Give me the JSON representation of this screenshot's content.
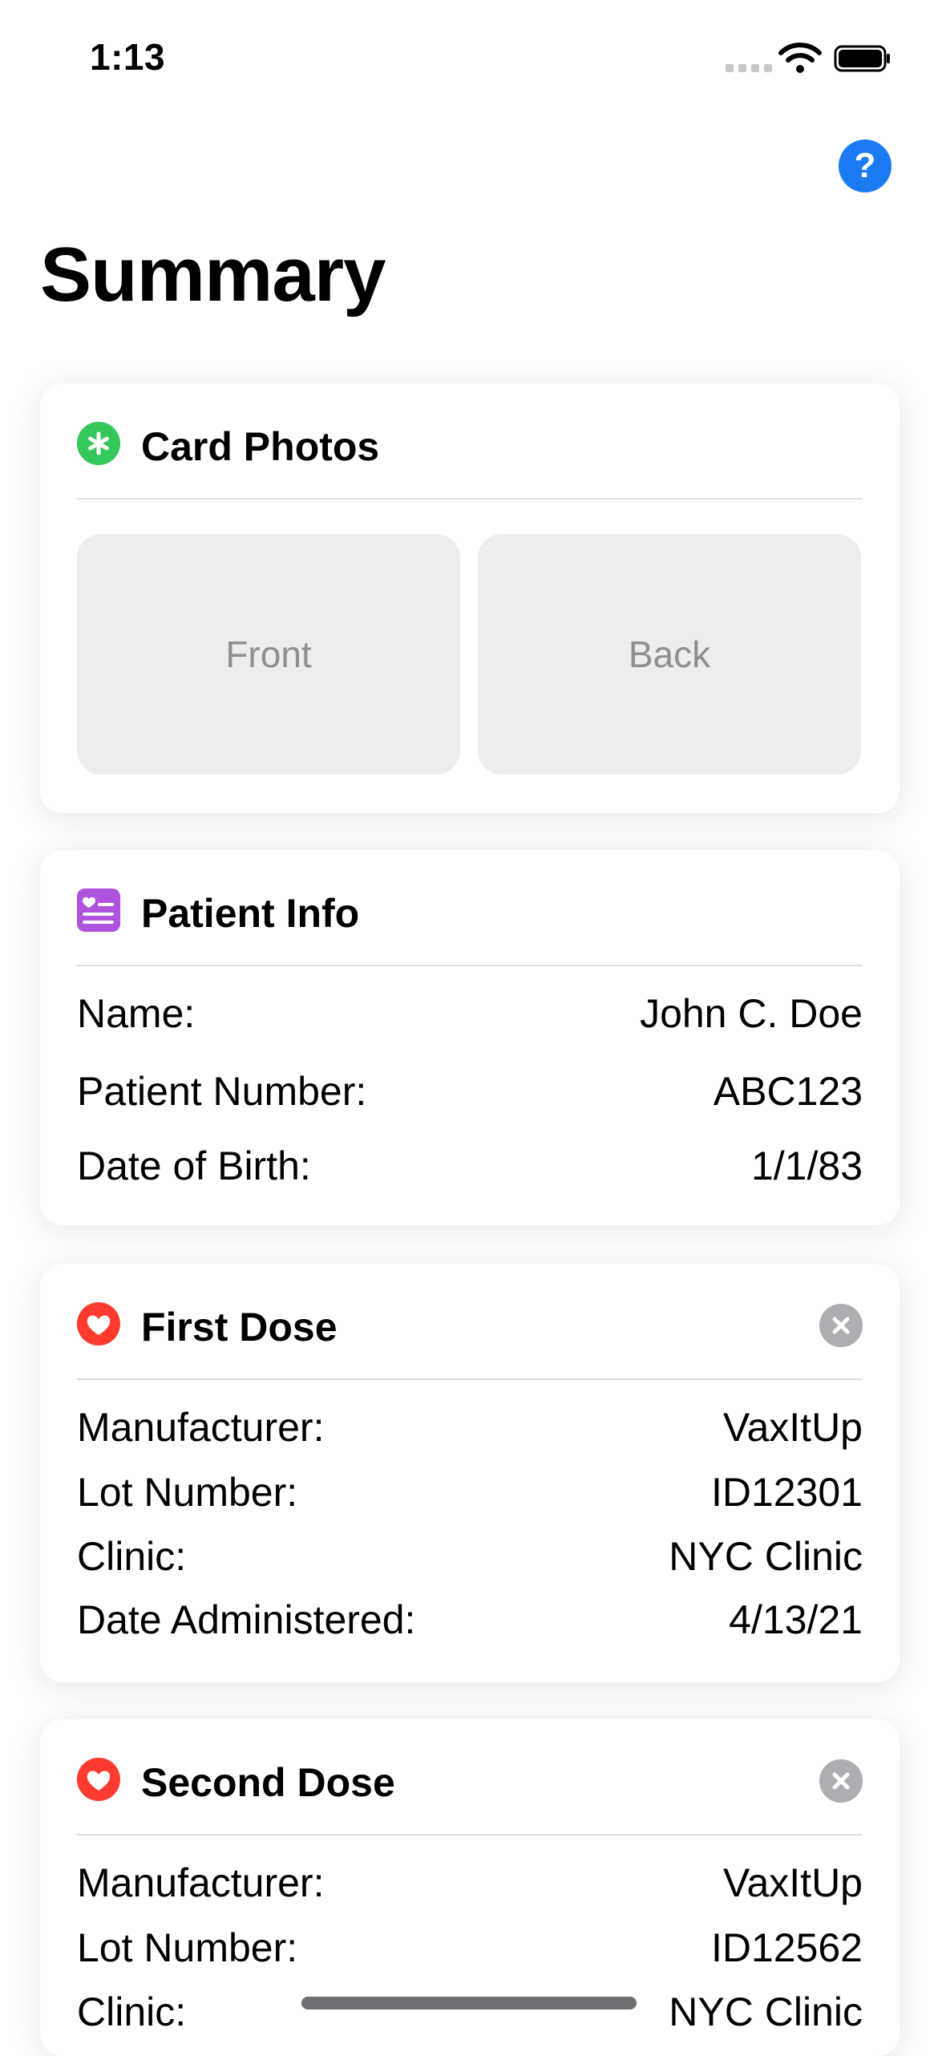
{
  "status_bar": {
    "time": "1:13"
  },
  "page": {
    "title": "Summary",
    "help_label": "?"
  },
  "card_photos": {
    "title": "Card Photos",
    "front_label": "Front",
    "back_label": "Back"
  },
  "patient_info": {
    "title": "Patient Info",
    "rows": [
      {
        "label": "Name:",
        "value": "John C. Doe"
      },
      {
        "label": "Patient Number:",
        "value": "ABC123"
      },
      {
        "label": "Date of Birth:",
        "value": "1/1/83"
      }
    ]
  },
  "first_dose": {
    "title": "First Dose",
    "rows": [
      {
        "label": "Manufacturer:",
        "value": "VaxItUp"
      },
      {
        "label": "Lot Number:",
        "value": "ID12301"
      },
      {
        "label": "Clinic:",
        "value": "NYC Clinic"
      },
      {
        "label": "Date Administered:",
        "value": "4/13/21"
      }
    ]
  },
  "second_dose": {
    "title": "Second Dose",
    "rows": [
      {
        "label": "Manufacturer:",
        "value": "VaxItUp"
      },
      {
        "label": "Lot Number:",
        "value": "ID12562"
      },
      {
        "label": "Clinic:",
        "value": "NYC Clinic"
      }
    ]
  },
  "colors": {
    "accent_blue": "#1a7bf2",
    "photos_icon_green": "#34c759",
    "patient_icon_purple": "#af52de",
    "dose_icon_red": "#ff3b30",
    "dismiss_gray": "#aeaeb2"
  },
  "icons": {
    "card_photos": "asterisk-circle-icon",
    "patient_info": "heart-text-square-icon",
    "dose": "heart-circle-icon",
    "dismiss": "xmark-circle-icon",
    "help": "questionmark-circle-icon"
  }
}
